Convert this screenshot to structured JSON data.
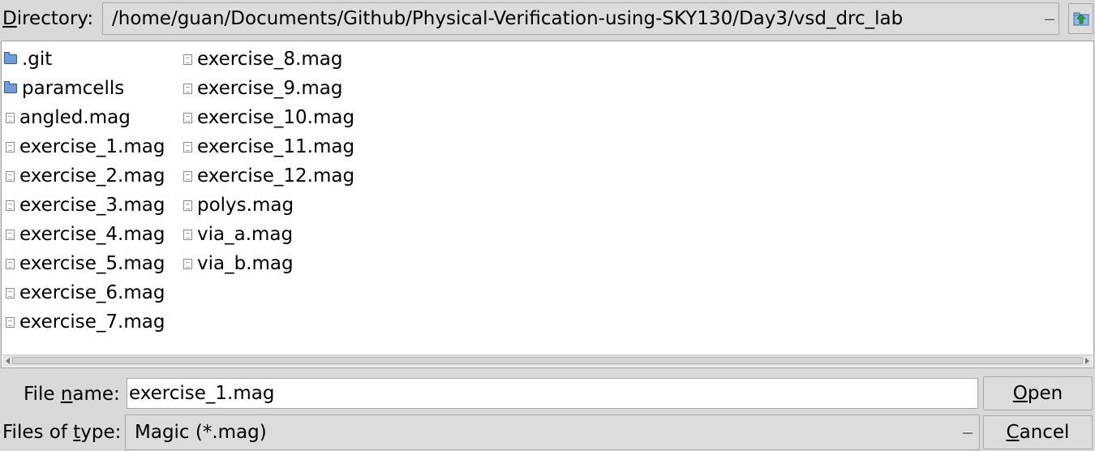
{
  "directory": {
    "label_accel": "D",
    "label_rest": "irectory:",
    "path": "/home/guan/Documents/Github/Physical-Verification-using-SKY130/Day3/vsd_drc_lab"
  },
  "files": {
    "column1": [
      {
        "name": ".git",
        "icon": "folder-icon"
      },
      {
        "name": "paramcells",
        "icon": "folder-icon"
      },
      {
        "name": "angled.mag",
        "icon": "file-icon"
      },
      {
        "name": "exercise_1.mag",
        "icon": "file-icon"
      },
      {
        "name": "exercise_2.mag",
        "icon": "file-icon"
      },
      {
        "name": "exercise_3.mag",
        "icon": "file-icon"
      },
      {
        "name": "exercise_4.mag",
        "icon": "file-icon"
      },
      {
        "name": "exercise_5.mag",
        "icon": "file-icon"
      },
      {
        "name": "exercise_6.mag",
        "icon": "file-icon"
      },
      {
        "name": "exercise_7.mag",
        "icon": "file-icon"
      }
    ],
    "column2": [
      {
        "name": "exercise_8.mag",
        "icon": "file-icon"
      },
      {
        "name": "exercise_9.mag",
        "icon": "file-icon"
      },
      {
        "name": "exercise_10.mag",
        "icon": "file-icon"
      },
      {
        "name": "exercise_11.mag",
        "icon": "file-icon"
      },
      {
        "name": "exercise_12.mag",
        "icon": "file-icon"
      },
      {
        "name": "polys.mag",
        "icon": "file-icon"
      },
      {
        "name": "via_a.mag",
        "icon": "file-icon"
      },
      {
        "name": "via_b.mag",
        "icon": "file-icon"
      }
    ]
  },
  "filename": {
    "label_pre": "File ",
    "label_accel": "n",
    "label_post": "ame:",
    "value": "exercise_1.mag"
  },
  "filetype": {
    "label_pre": "Files of ",
    "label_accel": "t",
    "label_post": "ype:",
    "value": "Magic (*.mag)"
  },
  "buttons": {
    "open_accel": "O",
    "open_rest": "pen",
    "cancel_accel": "C",
    "cancel_rest": "ancel"
  },
  "colors": {
    "background": "#d9d9d9",
    "folder": "#6f9bd8",
    "up_arrow": "#2e9e3a"
  }
}
